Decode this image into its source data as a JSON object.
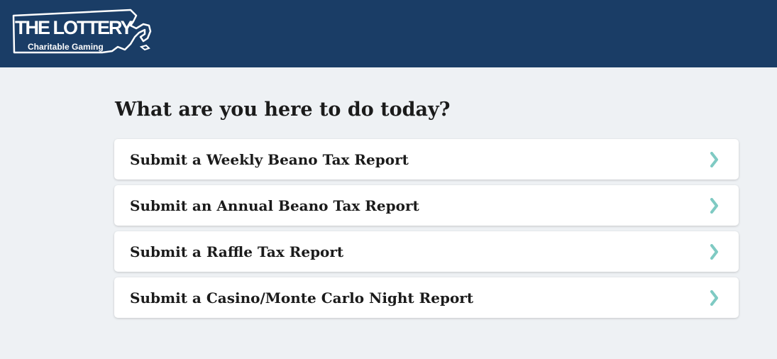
{
  "header": {
    "logo": {
      "title": "THE LOTTERY",
      "subtitle": "Charitable Gaming"
    },
    "background_color": "#1a3d66"
  },
  "main": {
    "title": "What are you here to do today?",
    "options": [
      {
        "label": "Submit a Weekly Beano Tax Report",
        "icon": "chevron-right-icon"
      },
      {
        "label": "Submit an Annual Beano Tax Report",
        "icon": "chevron-right-icon"
      },
      {
        "label": "Submit a Raffle Tax Report",
        "icon": "chevron-right-icon"
      },
      {
        "label": "Submit a Casino/Monte Carlo Night Report",
        "icon": "chevron-right-icon"
      }
    ]
  },
  "colors": {
    "accent": "#7fcac3",
    "page_background": "#eef1f4",
    "card_background": "#ffffff",
    "text": "#1b1b1b"
  }
}
